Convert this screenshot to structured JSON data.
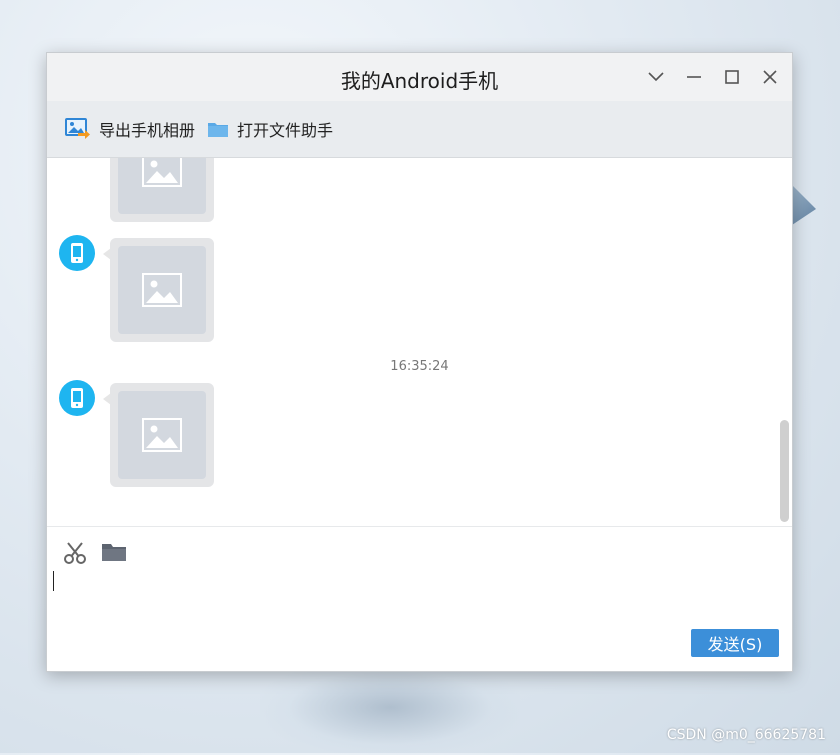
{
  "window": {
    "title": "我的Android手机"
  },
  "toolbar": {
    "export_album_label": "导出手机相册",
    "open_file_assistant_label": "打开文件助手"
  },
  "chat": {
    "timestamp": "16:35:24"
  },
  "input": {
    "send_label": "发送(S)"
  },
  "watermark": "CSDN @m0_66625781",
  "colors": {
    "accent": "#3c8fd9",
    "avatar": "#1eb5f0",
    "image_placeholder": "#d3d8df"
  }
}
